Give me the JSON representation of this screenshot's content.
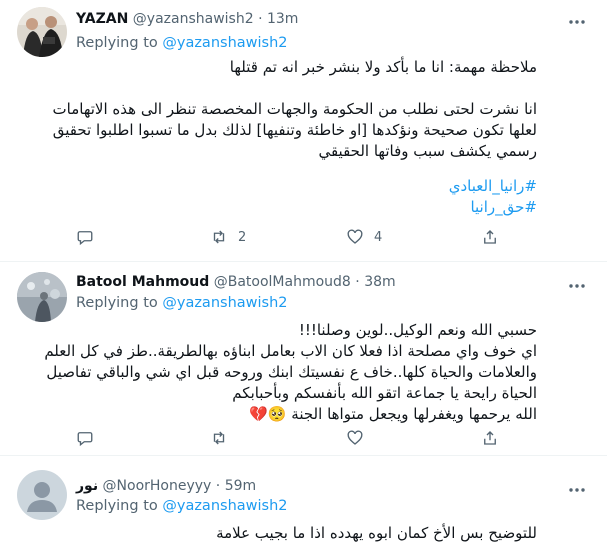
{
  "tweets": [
    {
      "name": "YAZAN",
      "handle": "@yazanshawish2",
      "time": "13m",
      "replying_prefix": "Replying to",
      "replying_to": "@yazanshawish2",
      "lines": [
        "ملاحظة مهمة: انا ما بأكد ولا بنشر خبر انه تم قتلها",
        "",
        "انا نشرت لحتى نطلب من الحكومة والجهات المخصصة تنظر الى هذه الاتهامات",
        "لعلها تكون صحيحة ونؤكدها [او خاطئة وتنفيها] لذلك بدل ما تسبوا اطلبوا تحقيق",
        "رسمي يكشف سبب وفاتها الحقيقي"
      ],
      "hashtags": [
        "#رانيا_العبادي",
        "#حق_رانيا"
      ],
      "actions": {
        "replies": "",
        "retweets": "2",
        "likes": "4"
      }
    },
    {
      "name": "Batool Mahmoud",
      "handle": "@BatoolMahmoud8",
      "time": "38m",
      "replying_prefix": "Replying to",
      "replying_to": "@yazanshawish2",
      "lines": [
        "حسبي الله ونعم الوكيل..لوين وصلنا!!!",
        "اي خوف واي مصلحة اذا فعلا كان الاب بعامل ابناؤه بهالطريقة..طز في كل العلم",
        "والعلامات والحياة كلها..خاف ع نفسيتك ابنك وروحه قبل اي شي والباقي تفاصيل",
        "الحياة رايحة يا جماعة اتقو الله بأنفسكم وبأحبابكم",
        "الله يرحمها ويغفرلها ويجعل متواها الجنة 🥺💔"
      ],
      "actions": {
        "replies": "",
        "retweets": "",
        "likes": ""
      }
    },
    {
      "name": "نور",
      "handle": "@NoorHoneyyy",
      "time": "59m",
      "replying_prefix": "Replying to",
      "replying_to": "@yazanshawish2",
      "lines": [
        "للتوضيح بس الأخ كمان ابوه يهدده اذا ما بجيب علامة"
      ]
    }
  ],
  "icons": {
    "more": "more-horizontal-icon",
    "reply": "reply-icon",
    "retweet": "retweet-icon",
    "like": "like-icon",
    "share": "share-icon"
  },
  "colors": {
    "link": "#1d9bf0",
    "muted": "#536471",
    "text": "#0f1419",
    "border": "#eff3f4"
  }
}
